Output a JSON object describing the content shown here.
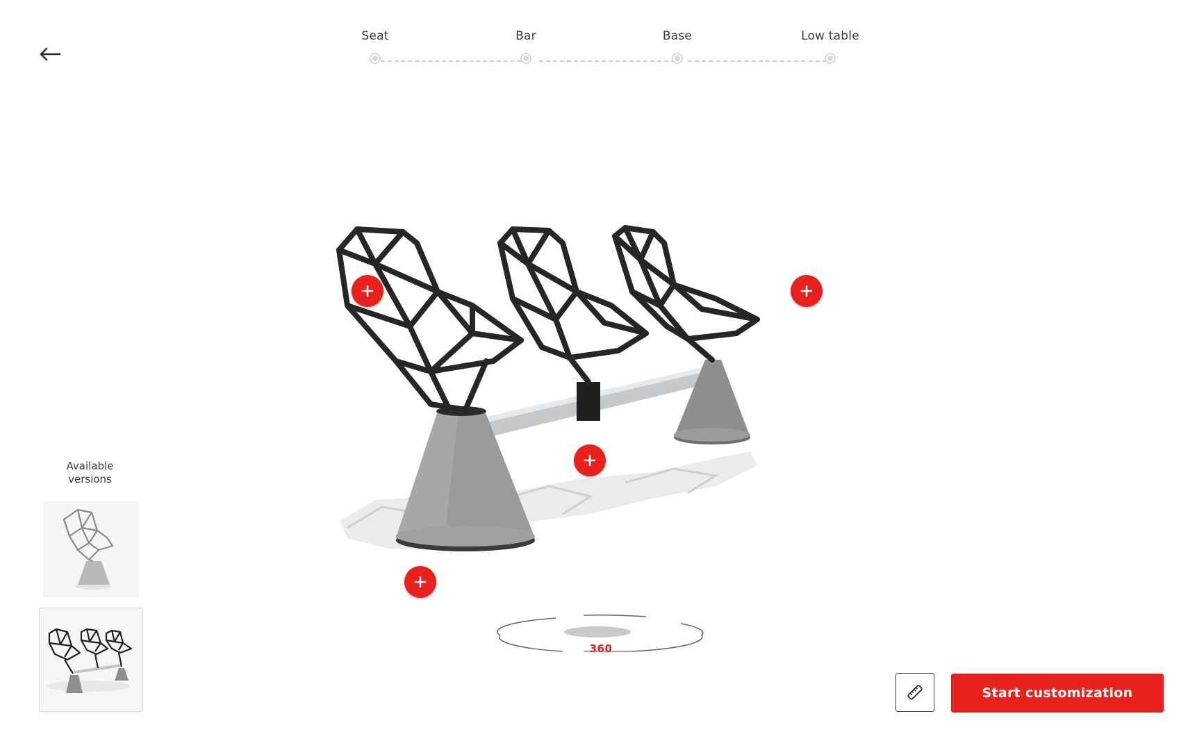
{
  "nav": {
    "back_icon": "arrow-left-icon"
  },
  "stepper": {
    "steps": [
      {
        "label": "Seat"
      },
      {
        "label": "Bar"
      },
      {
        "label": "Base"
      },
      {
        "label": "Low table"
      }
    ]
  },
  "versions": {
    "label": "Available\nversions",
    "items": [
      {
        "name": "single-chair"
      },
      {
        "name": "three-seat-bench",
        "selected": true
      }
    ]
  },
  "product": {
    "hotspot_icon": "plus-icon"
  },
  "rotate": {
    "label": "360"
  },
  "actions": {
    "measure_icon": "ruler-icon",
    "start_label": "Start customization"
  },
  "colors": {
    "accent": "#e8211c",
    "metal": "#2b2b2b",
    "concrete": "#9a9a9a",
    "step_dot": "#d3d8de"
  }
}
